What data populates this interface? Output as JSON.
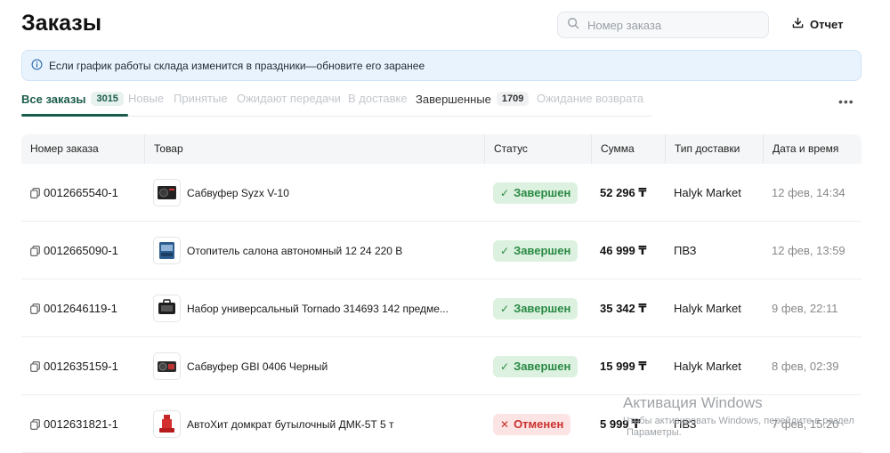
{
  "header": {
    "title": "Заказы",
    "search_placeholder": "Номер заказа",
    "report_label": "Отчет"
  },
  "banner": {
    "text": "Если график работы склада изменится в праздники—обновите его заранее"
  },
  "tabs": [
    {
      "label": "Все заказы",
      "count": "3015"
    },
    {
      "label": "Новые"
    },
    {
      "label": "Принятые"
    },
    {
      "label": "Ожидают передачи"
    },
    {
      "label": "В доставке"
    },
    {
      "label": "Завершенные",
      "count": "1709"
    },
    {
      "label": "Ожидание возврата"
    }
  ],
  "more_icon": "more-horizontal-icon",
  "table": {
    "columns": [
      "Номер заказа",
      "Товар",
      "Статус",
      "Сумма",
      "Тип доставки",
      "Дата и время"
    ],
    "rows": [
      {
        "order": "0012665540-1",
        "product": "Сабвуфер Syzx V-10",
        "status": "Завершен",
        "sum": "52 296 ₸",
        "delivery": "Halyk Market",
        "date": "12 фев, 14:34"
      },
      {
        "order": "0012665090-1",
        "product": "Отопитель салона автономный 12 24 220 В",
        "status": "Завершен",
        "sum": "46 999 ₸",
        "delivery": "ПВЗ",
        "date": "12 фев, 13:59"
      },
      {
        "order": "0012646119-1",
        "product": "Набор универсальный Tornado 314693 142 предме...",
        "status": "Завершен",
        "sum": "35 342 ₸",
        "delivery": "Halyk Market",
        "date": "9 фев, 22:11"
      },
      {
        "order": "0012635159-1",
        "product": "Сабвуфер GBI 0406 Черный",
        "status": "Завершен",
        "sum": "15 999 ₸",
        "delivery": "Halyk Market",
        "date": "8 фев, 02:39"
      },
      {
        "order": "0012631821-1",
        "product": "АвтоХит домкрат бутылочный ДМК-5Т 5 т",
        "status": "Отменен",
        "sum": "5 999 ₸",
        "delivery": "ПВЗ",
        "date": "7 фев, 15:20"
      }
    ]
  },
  "watermark": {
    "title": "Активация Windows",
    "line1": "Чтобы активировать Windows, перейдите в раздел",
    "line2": "Параметры."
  },
  "colors": {
    "accent": "#1a5c4a",
    "done_bg": "#dcf1df",
    "done_text": "#2a8a44",
    "cancel_bg": "#fde4e4",
    "cancel_text": "#c9302c",
    "banner_bg": "#e9f3fd"
  }
}
